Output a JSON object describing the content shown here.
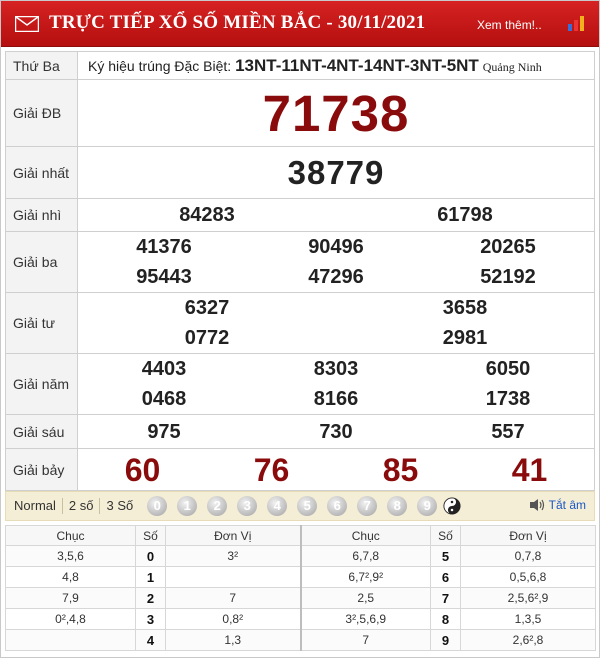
{
  "header": {
    "title": "TRỰC TIẾP XỔ SỐ MIỀN BẮC - 30/11/2021",
    "more_link": "Xem thêm!..",
    "color": "#c81818"
  },
  "subheader": {
    "day": "Thứ Ba",
    "code_label": "Ký hiệu trúng Đặc Biệt:",
    "code_value": "13NT-11NT-4NT-14NT-3NT-5NT",
    "province": "Quảng Ninh"
  },
  "prizes": {
    "db": {
      "label": "Giải ĐB",
      "values": [
        "71738"
      ]
    },
    "nhat": {
      "label": "Giải nhất",
      "values": [
        "38779"
      ]
    },
    "nhi": {
      "label": "Giải nhì",
      "values": [
        "84283",
        "61798"
      ]
    },
    "ba": {
      "label": "Giải ba",
      "values": [
        "41376",
        "90496",
        "20265",
        "95443",
        "47296",
        "52192"
      ]
    },
    "tu": {
      "label": "Giải tư",
      "values": [
        "6327",
        "3658",
        "0772",
        "2981"
      ]
    },
    "nam": {
      "label": "Giải năm",
      "values": [
        "4403",
        "8303",
        "6050",
        "0468",
        "8166",
        "1738"
      ]
    },
    "sau": {
      "label": "Giải sáu",
      "values": [
        "975",
        "730",
        "557"
      ]
    },
    "bay": {
      "label": "Giải bảy",
      "values": [
        "60",
        "76",
        "85",
        "41"
      ]
    },
    "accent_color": "#8a0b0b"
  },
  "filter": {
    "tabs": [
      "Normal",
      "2 số",
      "3 Số"
    ],
    "digits": [
      "0",
      "1",
      "2",
      "3",
      "4",
      "5",
      "6",
      "7",
      "8",
      "9"
    ],
    "sound_label": "Tắt âm"
  },
  "loto": {
    "headers": {
      "chuc": "Chục",
      "so": "Số",
      "donvi": "Đơn Vị"
    },
    "left": [
      {
        "chuc": "3,5,6",
        "so": "0",
        "donvi": "3²"
      },
      {
        "chuc": "4,8",
        "so": "1",
        "donvi": ""
      },
      {
        "chuc": "7,9",
        "so": "2",
        "donvi": "7"
      },
      {
        "chuc": "0²,4,8",
        "so": "3",
        "donvi": "0,8²"
      },
      {
        "chuc": "",
        "so": "4",
        "donvi": "1,3"
      }
    ],
    "right": [
      {
        "chuc": "6,7,8",
        "so": "5",
        "donvi": "0,7,8"
      },
      {
        "chuc": "6,7²,9²",
        "so": "6",
        "donvi": "0,5,6,8"
      },
      {
        "chuc": "2,5",
        "so": "7",
        "donvi": "2,5,6²,9"
      },
      {
        "chuc": "3²,5,6,9",
        "so": "8",
        "donvi": "1,3,5"
      },
      {
        "chuc": "7",
        "so": "9",
        "donvi": "2,6²,8"
      }
    ]
  }
}
